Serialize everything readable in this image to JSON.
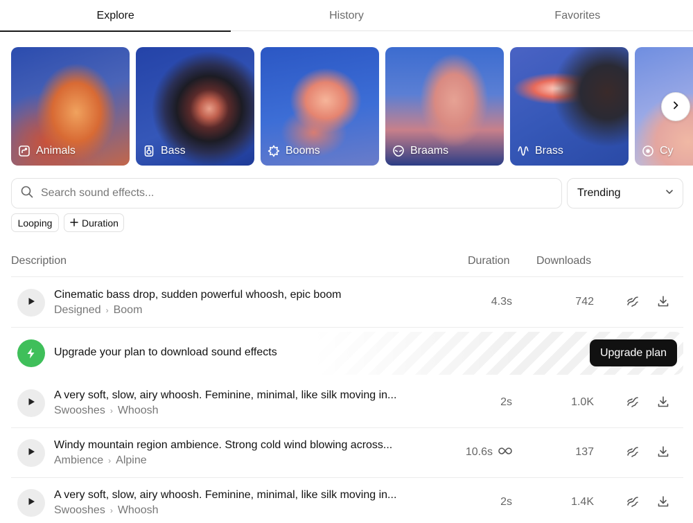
{
  "tabs": [
    {
      "label": "Explore",
      "active": true
    },
    {
      "label": "History",
      "active": false
    },
    {
      "label": "Favorites",
      "active": false
    }
  ],
  "categories": [
    {
      "label": "Animals",
      "icon": "animals-icon"
    },
    {
      "label": "Bass",
      "icon": "speaker-icon"
    },
    {
      "label": "Booms",
      "icon": "burst-icon"
    },
    {
      "label": "Braams",
      "icon": "alien-icon"
    },
    {
      "label": "Brass",
      "icon": "waveform-icon"
    },
    {
      "label": "Cy",
      "icon": "circle-icon"
    }
  ],
  "search": {
    "placeholder": "Search sound effects...",
    "value": ""
  },
  "sort": {
    "selected": "Trending"
  },
  "filters": {
    "looping_label": "Looping",
    "duration_label": "Duration"
  },
  "table": {
    "headers": {
      "description": "Description",
      "duration": "Duration",
      "downloads": "Downloads"
    },
    "rows": [
      {
        "title": "Cinematic bass drop, sudden powerful whoosh, epic boom",
        "category": "Designed",
        "subcategory": "Boom",
        "duration": "4.3s",
        "looping": false,
        "downloads": "742"
      },
      {
        "title": "A very soft, slow, airy whoosh. Feminine, minimal, like silk moving in...",
        "category": "Swooshes",
        "subcategory": "Whoosh",
        "duration": "2s",
        "looping": false,
        "downloads": "1.0K"
      },
      {
        "title": "Windy mountain region ambience. Strong cold wind blowing across...",
        "category": "Ambience",
        "subcategory": "Alpine",
        "duration": "10.6s",
        "looping": true,
        "downloads": "137"
      },
      {
        "title": "A very soft, slow, airy whoosh. Feminine, minimal, like silk moving in...",
        "category": "Swooshes",
        "subcategory": "Whoosh",
        "duration": "2s",
        "looping": false,
        "downloads": "1.4K"
      }
    ]
  },
  "upgrade": {
    "text": "Upgrade your plan to download sound effects",
    "button_label": "Upgrade plan"
  },
  "colors": {
    "accent_green": "#3fbf5a",
    "primary_button": "#111111"
  }
}
